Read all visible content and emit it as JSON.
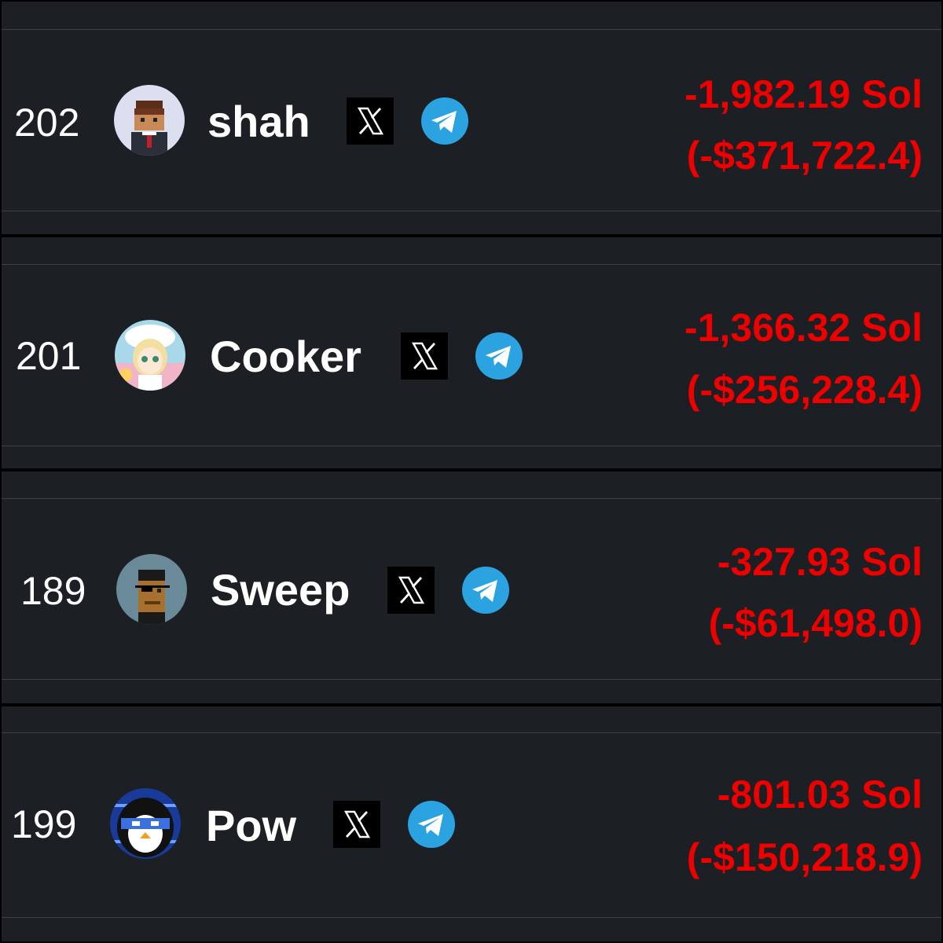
{
  "leaderboard": {
    "rows": [
      {
        "rank": "202",
        "name": "shah",
        "pnl_sol": "-1,982.19 Sol",
        "pnl_usd": "(-$371,722.4)",
        "x_icon": "x-logo-icon",
        "telegram_icon": "telegram-icon"
      },
      {
        "rank": "201",
        "name": "Cooker",
        "pnl_sol": "-1,366.32 Sol",
        "pnl_usd": "(-$256,228.4)",
        "x_icon": "x-logo-icon",
        "telegram_icon": "telegram-icon"
      },
      {
        "rank": "189",
        "name": "Sweep",
        "pnl_sol": "-327.93 Sol",
        "pnl_usd": "(-$61,498.0)",
        "x_icon": "x-logo-icon",
        "telegram_icon": "telegram-icon"
      },
      {
        "rank": "199",
        "name": "Pow",
        "pnl_sol": "-801.03 Sol",
        "pnl_usd": "(-$150,218.9)",
        "x_icon": "x-logo-icon",
        "telegram_icon": "telegram-icon"
      }
    ]
  },
  "colors": {
    "background": "#000000",
    "panel": "#1c1f23",
    "divider": "#3c4046",
    "text": "#ffffff",
    "loss": "#ee0000",
    "telegram": "#2aa3e0"
  }
}
